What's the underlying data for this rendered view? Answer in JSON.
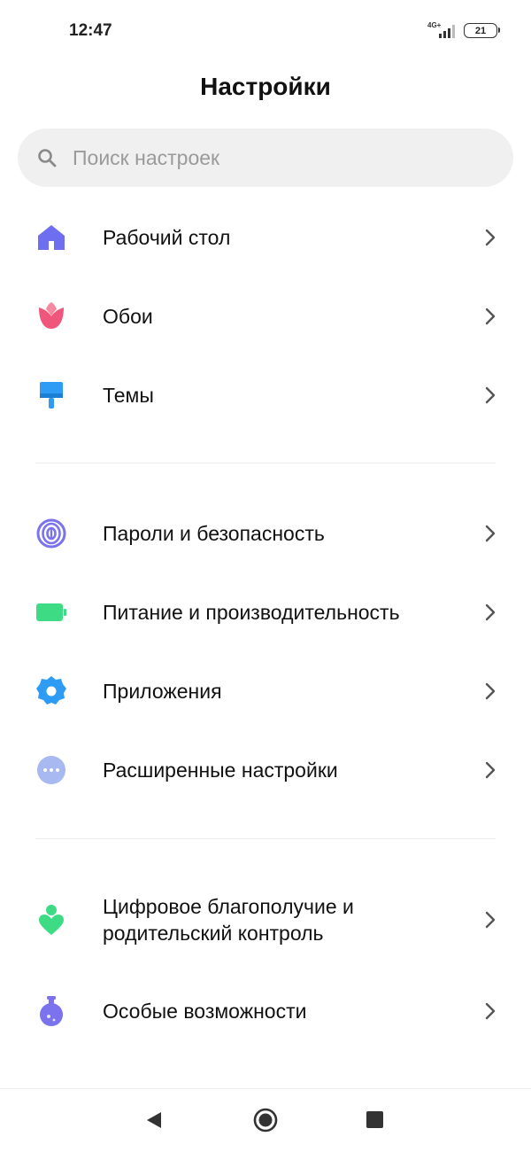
{
  "status_bar": {
    "time": "12:47",
    "network": "4G+",
    "network_sub": "LTE",
    "battery": "21"
  },
  "header": {
    "title": "Настройки"
  },
  "search": {
    "placeholder": "Поиск настроек"
  },
  "groups": [
    {
      "items": [
        {
          "label": "Рабочий стол",
          "icon": "home-icon",
          "color": "#6e6ef0"
        },
        {
          "label": "Обои",
          "icon": "tulip-icon",
          "color": "#f0557c"
        },
        {
          "label": "Темы",
          "icon": "paint-brush-icon",
          "color": "#2e9cf5"
        }
      ]
    },
    {
      "items": [
        {
          "label": "Пароли и безопасность",
          "icon": "fingerprint-icon",
          "color": "#7b72ee"
        },
        {
          "label": "Питание и производительность",
          "icon": "battery-icon",
          "color": "#3ddc84"
        },
        {
          "label": "Приложения",
          "icon": "gear-icon",
          "color": "#2e9cf5"
        },
        {
          "label": "Расширенные настройки",
          "icon": "more-dots-icon",
          "color": "#a8b8f0"
        }
      ]
    },
    {
      "items": [
        {
          "label": "Цифровое благополучие и родительский контроль",
          "icon": "wellbeing-heart-icon",
          "color": "#3ddc84"
        },
        {
          "label": "Особые возможности",
          "icon": "flask-icon",
          "color": "#7b72ee"
        }
      ]
    }
  ],
  "nav": {
    "back": "back-icon",
    "home": "home-circle-icon",
    "recent": "recent-apps-icon"
  }
}
